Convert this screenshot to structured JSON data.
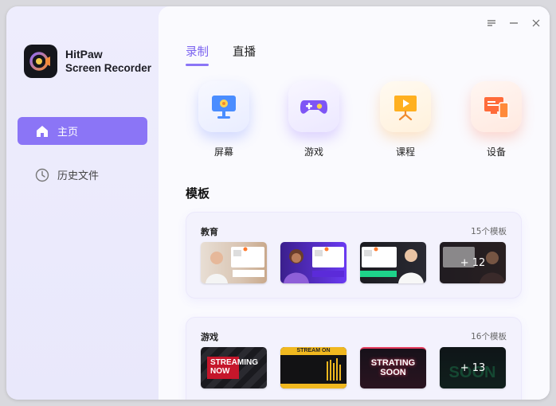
{
  "app": {
    "brand_line1": "HitPaw",
    "brand_line2": "Screen Recorder",
    "accent": "#8b75f6"
  },
  "sidebar": {
    "items": [
      {
        "label": "主页",
        "icon": "home-icon",
        "active": true
      },
      {
        "label": "历史文件",
        "icon": "clock-icon",
        "active": false
      }
    ]
  },
  "window_controls": [
    "menu-icon",
    "minimize-icon",
    "close-icon"
  ],
  "tabs": [
    {
      "label": "录制",
      "active": true
    },
    {
      "label": "直播",
      "active": false
    }
  ],
  "modes": [
    {
      "label": "屏幕",
      "icon": "monitor-icon"
    },
    {
      "label": "游戏",
      "icon": "gamepad-icon"
    },
    {
      "label": "课程",
      "icon": "presentation-icon"
    },
    {
      "label": "设备",
      "icon": "device-icon"
    }
  ],
  "templates": {
    "title": "模板",
    "groups": [
      {
        "name": "教育",
        "count": "15个模板",
        "thumbs": [
          {
            "label": ""
          },
          {
            "label": ""
          },
          {
            "label": ""
          },
          {
            "label": "+ 12"
          }
        ]
      },
      {
        "name": "游戏",
        "count": "16个模板",
        "thumbs": [
          {
            "label": "STREAMING NOW"
          },
          {
            "label": "STREAM ON"
          },
          {
            "label": "STRATING SOON"
          },
          {
            "label": "+ 13"
          }
        ]
      }
    ]
  }
}
